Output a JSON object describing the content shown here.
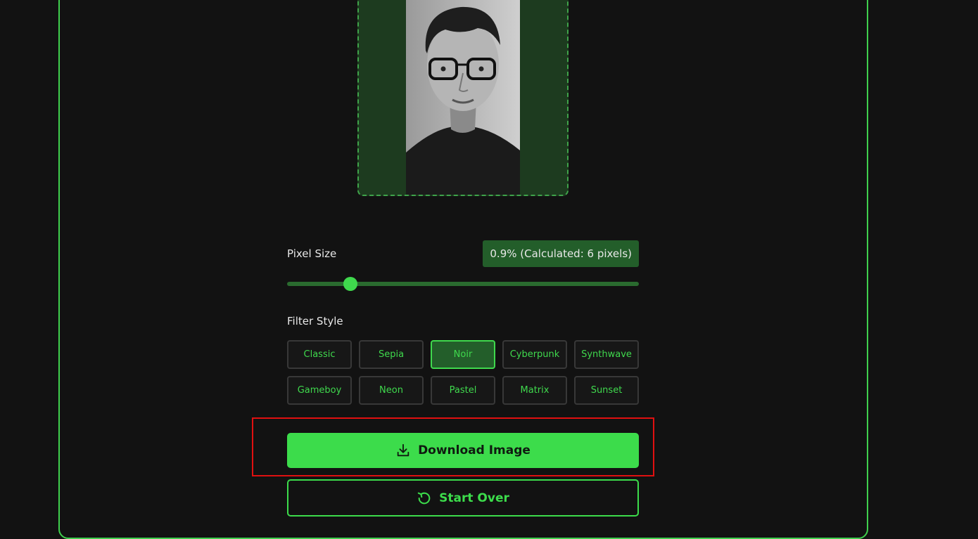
{
  "pixel_size": {
    "label": "Pixel Size",
    "value_badge": "0.9% (Calculated: 6 pixels)",
    "slider_fraction": 0.18
  },
  "filter_style": {
    "label": "Filter Style",
    "options": [
      "Classic",
      "Sepia",
      "Noir",
      "Cyberpunk",
      "Synthwave",
      "Gameboy",
      "Neon",
      "Pastel",
      "Matrix",
      "Sunset"
    ],
    "selected": "Noir"
  },
  "actions": {
    "download_label": "Download Image",
    "start_over_label": "Start Over"
  },
  "colors": {
    "accent": "#3cdc4b",
    "background": "#121212",
    "highlight": "#e01010"
  },
  "icons": {
    "download": "download-icon",
    "start_over": "refresh-icon"
  }
}
